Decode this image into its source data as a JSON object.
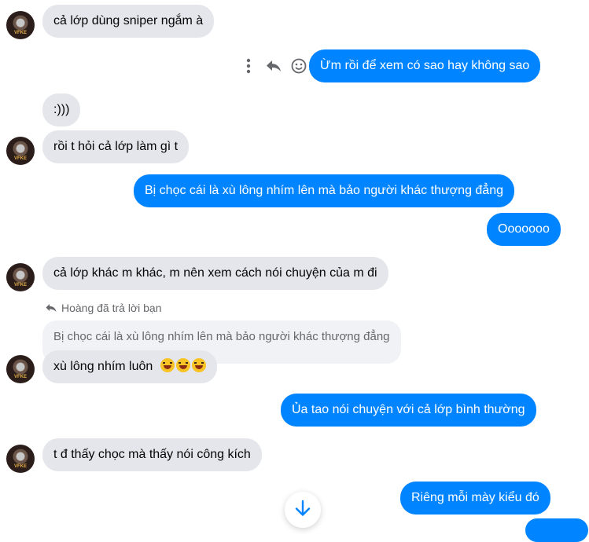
{
  "messages": [
    {
      "dir": "in",
      "text": "cả lớp dùng sniper ngắm à"
    },
    {
      "dir": "out",
      "text": "Ừm rồi để xem có sao hay không sao"
    },
    {
      "dir": "in",
      "text": ":)))"
    },
    {
      "dir": "in",
      "text": "rồi t hỏi cả lớp làm gì t"
    },
    {
      "dir": "out",
      "text": "Bị chọc cái là xù lông nhím lên mà bảo người khác thượng đẳng"
    },
    {
      "dir": "out",
      "text": "Ooooooo"
    },
    {
      "dir": "in",
      "text": "cả lớp khác m khác, m nên xem cách nói chuyện của m đi"
    },
    {
      "dir": "in",
      "text": "xù lông nhím luôn"
    },
    {
      "dir": "out",
      "text": "Ủa tao nói chuyện với cả lớp bình thường"
    },
    {
      "dir": "in",
      "text": "t đ thấy chọc mà thấy nói công kích"
    },
    {
      "dir": "out",
      "text": "Riêng mỗi mày kiểu đó"
    }
  ],
  "reply": {
    "label": "Hoàng đã trả lời bạn",
    "quoted": "Bị chọc cái là xù lông nhím lên mà bảo người khác thượng đẳng"
  },
  "avatar_text": "VFKE",
  "colors": {
    "outgoing": "#0084ff",
    "incoming": "#e4e6eb",
    "meta": "#65676b",
    "background": "#ffffff"
  },
  "icons": [
    "more-options-icon",
    "reply-icon",
    "emoji-reaction-icon",
    "reply-arrow-icon",
    "laughing-emoji-icon",
    "scroll-down-icon"
  ]
}
